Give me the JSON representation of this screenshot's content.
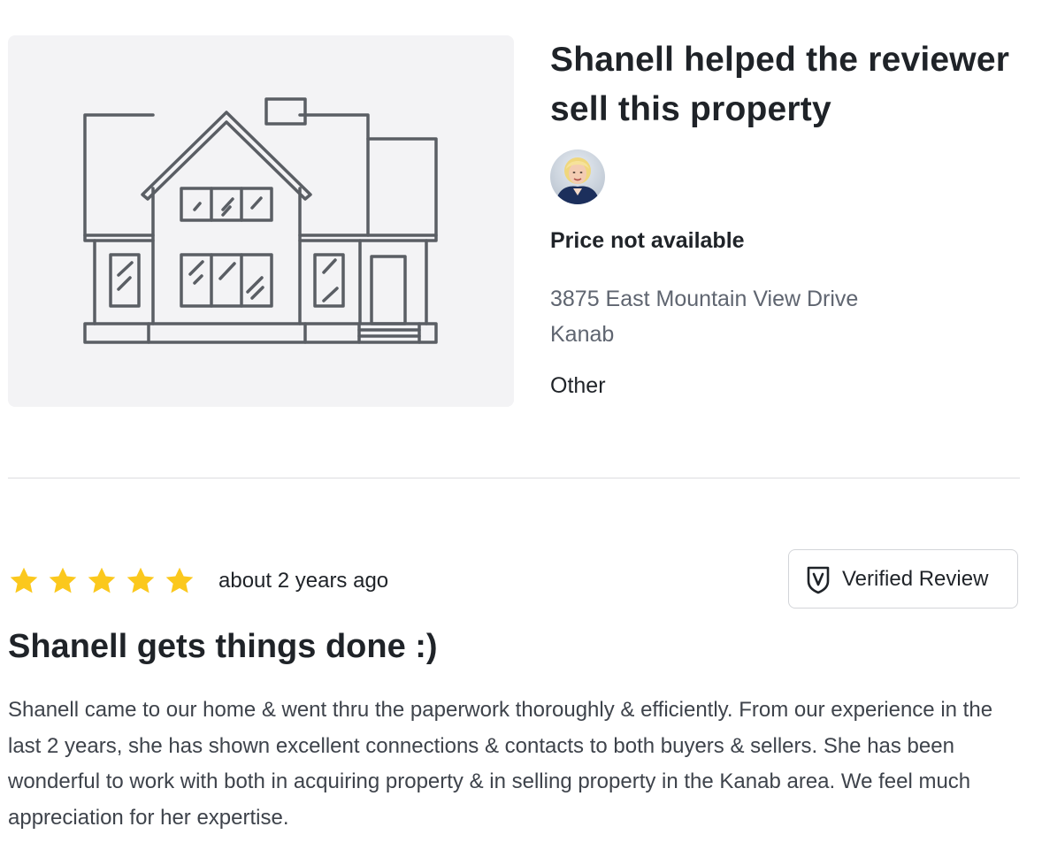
{
  "property": {
    "image_alt": "house-illustration",
    "headline": "Shanell helped the reviewer sell this property",
    "price": "Price not available",
    "address_line1": "3875 East Mountain View Drive",
    "address_line2": "Kanab",
    "type": "Other"
  },
  "review": {
    "rating": 5,
    "max_rating": 5,
    "age": "about 2 years ago",
    "verified_label": "Verified Review",
    "title": "Shanell gets things done :)",
    "body": "Shanell came to our home & went thru the paperwork thoroughly & efficiently. From our experience in the last 2 years, she has shown excellent connections & contacts to both buyers & sellers. She has been wonderful to work with both in acquiring property & in selling property in the Kanab area. We feel much appreciation for her expertise."
  },
  "colors": {
    "text_dark": "#1f2328",
    "text_muted": "#5f6570",
    "star": "#fbc81d",
    "image_bg": "#f3f3f5",
    "divider": "#dcdde0",
    "house_stroke": "#5a5e64"
  }
}
